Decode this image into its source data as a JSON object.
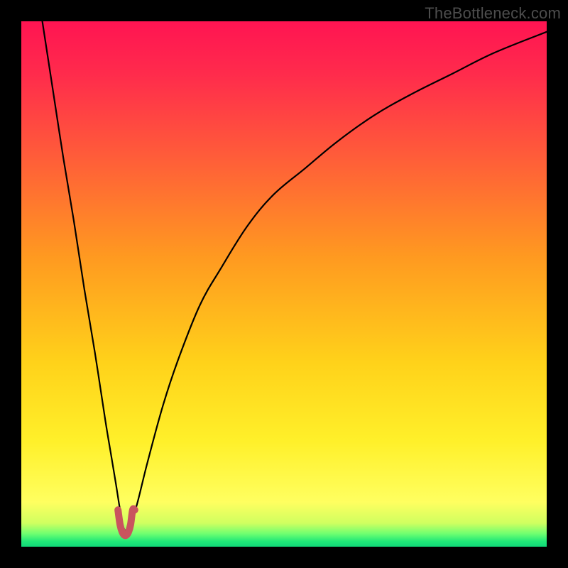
{
  "attribution": "TheBottleneck.com",
  "chart_data": {
    "type": "line",
    "title": "",
    "xlabel": "",
    "ylabel": "",
    "xlim": [
      0,
      100
    ],
    "ylim": [
      0,
      100
    ],
    "series": [
      {
        "name": "bottleneck-curve",
        "x": [
          4,
          6,
          8,
          10,
          12,
          14,
          16,
          17,
          18,
          18.8,
          19.5,
          20.5,
          22,
          24,
          27,
          30,
          34,
          38,
          43,
          48,
          54,
          60,
          67,
          74,
          82,
          90,
          100
        ],
        "y": [
          100,
          87,
          74,
          62,
          49,
          37,
          24,
          18,
          12,
          7,
          3.5,
          3.5,
          8,
          16,
          27,
          36,
          46,
          53,
          61,
          67,
          72,
          77,
          82,
          86,
          90,
          94,
          98
        ]
      },
      {
        "name": "valley-marker",
        "x": [
          18.4,
          18.8,
          19.2,
          19.6,
          20.0,
          20.4,
          20.8,
          21.2,
          21.6
        ],
        "y": [
          7.0,
          4.2,
          2.8,
          2.2,
          2.2,
          2.8,
          4.2,
          7.0,
          7.0
        ]
      }
    ],
    "annotations": []
  },
  "gradient": {
    "stops": [
      {
        "offset": 0.0,
        "color": "#ff1452"
      },
      {
        "offset": 0.1,
        "color": "#ff2b4c"
      },
      {
        "offset": 0.25,
        "color": "#ff5a3a"
      },
      {
        "offset": 0.45,
        "color": "#ff9a20"
      },
      {
        "offset": 0.65,
        "color": "#ffd21a"
      },
      {
        "offset": 0.8,
        "color": "#fff02a"
      },
      {
        "offset": 0.915,
        "color": "#ffff60"
      },
      {
        "offset": 0.955,
        "color": "#d0ff60"
      },
      {
        "offset": 0.975,
        "color": "#70ff70"
      },
      {
        "offset": 0.99,
        "color": "#20e878"
      },
      {
        "offset": 1.0,
        "color": "#10d878"
      }
    ]
  },
  "styles": {
    "curve_stroke": "#000000",
    "curve_width": 2.2,
    "marker_stroke": "#c9545e",
    "marker_width": 10,
    "frame_color": "#000000"
  }
}
